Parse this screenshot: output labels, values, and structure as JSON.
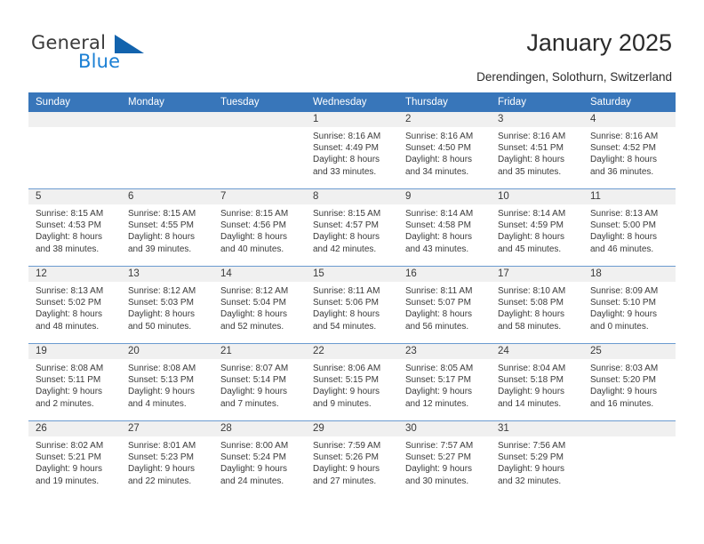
{
  "brand": {
    "word1": "General",
    "word2": "Blue",
    "triangle_color": "#1263ad",
    "blue_color": "#1a7fd4"
  },
  "header": {
    "title": "January 2025",
    "subtitle": "Derendingen, Solothurn, Switzerland",
    "header_bg": "#3876ba",
    "header_text_color": "#ffffff"
  },
  "weekday_headers": [
    "Sunday",
    "Monday",
    "Tuesday",
    "Wednesday",
    "Thursday",
    "Friday",
    "Saturday"
  ],
  "weeks": [
    [
      {
        "day": "",
        "sunrise": "",
        "sunset": "",
        "daylight1": "",
        "daylight2": "",
        "empty": true
      },
      {
        "day": "",
        "sunrise": "",
        "sunset": "",
        "daylight1": "",
        "daylight2": "",
        "empty": true
      },
      {
        "day": "",
        "sunrise": "",
        "sunset": "",
        "daylight1": "",
        "daylight2": "",
        "empty": true
      },
      {
        "day": "1",
        "sunrise": "Sunrise: 8:16 AM",
        "sunset": "Sunset: 4:49 PM",
        "daylight1": "Daylight: 8 hours",
        "daylight2": "and 33 minutes."
      },
      {
        "day": "2",
        "sunrise": "Sunrise: 8:16 AM",
        "sunset": "Sunset: 4:50 PM",
        "daylight1": "Daylight: 8 hours",
        "daylight2": "and 34 minutes."
      },
      {
        "day": "3",
        "sunrise": "Sunrise: 8:16 AM",
        "sunset": "Sunset: 4:51 PM",
        "daylight1": "Daylight: 8 hours",
        "daylight2": "and 35 minutes."
      },
      {
        "day": "4",
        "sunrise": "Sunrise: 8:16 AM",
        "sunset": "Sunset: 4:52 PM",
        "daylight1": "Daylight: 8 hours",
        "daylight2": "and 36 minutes."
      }
    ],
    [
      {
        "day": "5",
        "sunrise": "Sunrise: 8:15 AM",
        "sunset": "Sunset: 4:53 PM",
        "daylight1": "Daylight: 8 hours",
        "daylight2": "and 38 minutes."
      },
      {
        "day": "6",
        "sunrise": "Sunrise: 8:15 AM",
        "sunset": "Sunset: 4:55 PM",
        "daylight1": "Daylight: 8 hours",
        "daylight2": "and 39 minutes."
      },
      {
        "day": "7",
        "sunrise": "Sunrise: 8:15 AM",
        "sunset": "Sunset: 4:56 PM",
        "daylight1": "Daylight: 8 hours",
        "daylight2": "and 40 minutes."
      },
      {
        "day": "8",
        "sunrise": "Sunrise: 8:15 AM",
        "sunset": "Sunset: 4:57 PM",
        "daylight1": "Daylight: 8 hours",
        "daylight2": "and 42 minutes."
      },
      {
        "day": "9",
        "sunrise": "Sunrise: 8:14 AM",
        "sunset": "Sunset: 4:58 PM",
        "daylight1": "Daylight: 8 hours",
        "daylight2": "and 43 minutes."
      },
      {
        "day": "10",
        "sunrise": "Sunrise: 8:14 AM",
        "sunset": "Sunset: 4:59 PM",
        "daylight1": "Daylight: 8 hours",
        "daylight2": "and 45 minutes."
      },
      {
        "day": "11",
        "sunrise": "Sunrise: 8:13 AM",
        "sunset": "Sunset: 5:00 PM",
        "daylight1": "Daylight: 8 hours",
        "daylight2": "and 46 minutes."
      }
    ],
    [
      {
        "day": "12",
        "sunrise": "Sunrise: 8:13 AM",
        "sunset": "Sunset: 5:02 PM",
        "daylight1": "Daylight: 8 hours",
        "daylight2": "and 48 minutes."
      },
      {
        "day": "13",
        "sunrise": "Sunrise: 8:12 AM",
        "sunset": "Sunset: 5:03 PM",
        "daylight1": "Daylight: 8 hours",
        "daylight2": "and 50 minutes."
      },
      {
        "day": "14",
        "sunrise": "Sunrise: 8:12 AM",
        "sunset": "Sunset: 5:04 PM",
        "daylight1": "Daylight: 8 hours",
        "daylight2": "and 52 minutes."
      },
      {
        "day": "15",
        "sunrise": "Sunrise: 8:11 AM",
        "sunset": "Sunset: 5:06 PM",
        "daylight1": "Daylight: 8 hours",
        "daylight2": "and 54 minutes."
      },
      {
        "day": "16",
        "sunrise": "Sunrise: 8:11 AM",
        "sunset": "Sunset: 5:07 PM",
        "daylight1": "Daylight: 8 hours",
        "daylight2": "and 56 minutes."
      },
      {
        "day": "17",
        "sunrise": "Sunrise: 8:10 AM",
        "sunset": "Sunset: 5:08 PM",
        "daylight1": "Daylight: 8 hours",
        "daylight2": "and 58 minutes."
      },
      {
        "day": "18",
        "sunrise": "Sunrise: 8:09 AM",
        "sunset": "Sunset: 5:10 PM",
        "daylight1": "Daylight: 9 hours",
        "daylight2": "and 0 minutes."
      }
    ],
    [
      {
        "day": "19",
        "sunrise": "Sunrise: 8:08 AM",
        "sunset": "Sunset: 5:11 PM",
        "daylight1": "Daylight: 9 hours",
        "daylight2": "and 2 minutes."
      },
      {
        "day": "20",
        "sunrise": "Sunrise: 8:08 AM",
        "sunset": "Sunset: 5:13 PM",
        "daylight1": "Daylight: 9 hours",
        "daylight2": "and 4 minutes."
      },
      {
        "day": "21",
        "sunrise": "Sunrise: 8:07 AM",
        "sunset": "Sunset: 5:14 PM",
        "daylight1": "Daylight: 9 hours",
        "daylight2": "and 7 minutes."
      },
      {
        "day": "22",
        "sunrise": "Sunrise: 8:06 AM",
        "sunset": "Sunset: 5:15 PM",
        "daylight1": "Daylight: 9 hours",
        "daylight2": "and 9 minutes."
      },
      {
        "day": "23",
        "sunrise": "Sunrise: 8:05 AM",
        "sunset": "Sunset: 5:17 PM",
        "daylight1": "Daylight: 9 hours",
        "daylight2": "and 12 minutes."
      },
      {
        "day": "24",
        "sunrise": "Sunrise: 8:04 AM",
        "sunset": "Sunset: 5:18 PM",
        "daylight1": "Daylight: 9 hours",
        "daylight2": "and 14 minutes."
      },
      {
        "day": "25",
        "sunrise": "Sunrise: 8:03 AM",
        "sunset": "Sunset: 5:20 PM",
        "daylight1": "Daylight: 9 hours",
        "daylight2": "and 16 minutes."
      }
    ],
    [
      {
        "day": "26",
        "sunrise": "Sunrise: 8:02 AM",
        "sunset": "Sunset: 5:21 PM",
        "daylight1": "Daylight: 9 hours",
        "daylight2": "and 19 minutes."
      },
      {
        "day": "27",
        "sunrise": "Sunrise: 8:01 AM",
        "sunset": "Sunset: 5:23 PM",
        "daylight1": "Daylight: 9 hours",
        "daylight2": "and 22 minutes."
      },
      {
        "day": "28",
        "sunrise": "Sunrise: 8:00 AM",
        "sunset": "Sunset: 5:24 PM",
        "daylight1": "Daylight: 9 hours",
        "daylight2": "and 24 minutes."
      },
      {
        "day": "29",
        "sunrise": "Sunrise: 7:59 AM",
        "sunset": "Sunset: 5:26 PM",
        "daylight1": "Daylight: 9 hours",
        "daylight2": "and 27 minutes."
      },
      {
        "day": "30",
        "sunrise": "Sunrise: 7:57 AM",
        "sunset": "Sunset: 5:27 PM",
        "daylight1": "Daylight: 9 hours",
        "daylight2": "and 30 minutes."
      },
      {
        "day": "31",
        "sunrise": "Sunrise: 7:56 AM",
        "sunset": "Sunset: 5:29 PM",
        "daylight1": "Daylight: 9 hours",
        "daylight2": "and 32 minutes."
      },
      {
        "day": "",
        "sunrise": "",
        "sunset": "",
        "daylight1": "",
        "daylight2": "",
        "empty": true
      }
    ]
  ]
}
